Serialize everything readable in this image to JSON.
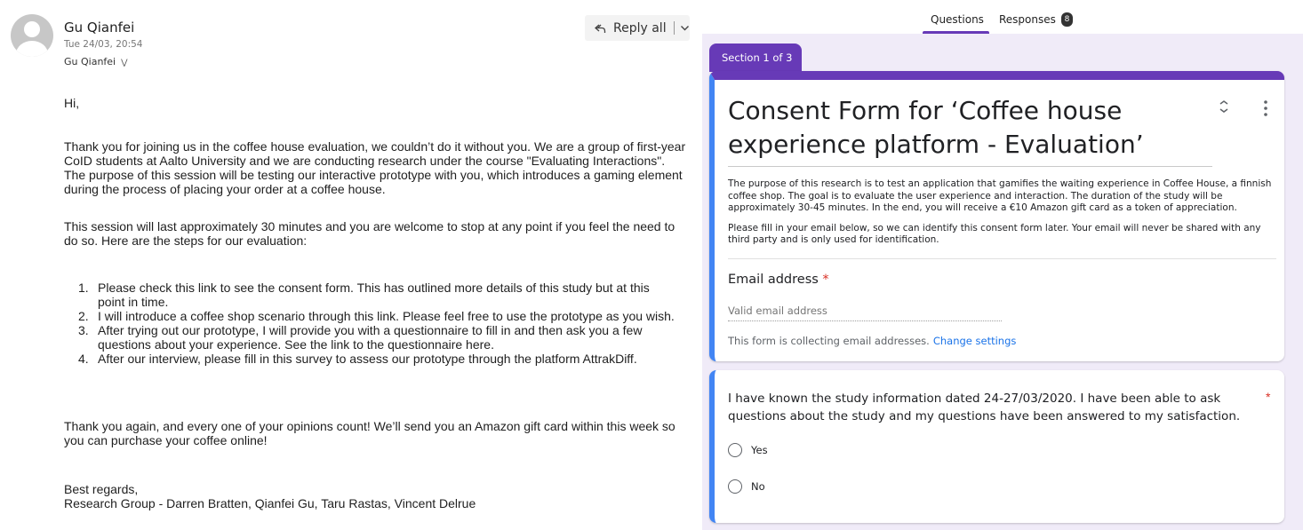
{
  "email": {
    "sender_name": "Gu Qianfei",
    "sent_date": "Tue 24/03, 20:54",
    "to": "Gu Qianfei",
    "reply_all_label": "Reply all",
    "greeting": "Hi,",
    "para1": "Thank you for joining us in the coffee house evaluation, we couldn’t do it without you. We are a group of first-year CoID students at Aalto University and we are conducting research under the course \"Evaluating Interactions\". The purpose of this session will be testing our interactive prototype with you, which introduces a gaming element during the process of placing your order at a coffee house.",
    "para2": "This session will last approximately 30 minutes and you are welcome to stop at any point if you feel the need to do so. Here are the steps for our evaluation:",
    "steps": [
      {
        "num": "1.",
        "before": "Please check ",
        "link": "this link",
        "after": " to see the consent form. This has outlined more details of this study but at this point in time."
      },
      {
        "num": "2.",
        "before": "I will introduce a coffee shop scenario ",
        "link": "through this link",
        "after": ". Please feel free to use the prototype as you wish."
      },
      {
        "num": "3.",
        "before": "After trying out our prototype, I will provide you with a questionnaire to fill in and then ask you a few questions about your experience. See ",
        "link": "the link to the questionnaire",
        "after": " here."
      },
      {
        "num": "4.",
        "before": "After our interview, please fill in ",
        "link": "this survey",
        "after": " to assess our prototype through the platform AttrakDiff."
      }
    ],
    "para3": "Thank you again, and every one of your opinions count! We’ll send you an Amazon gift card within this week so you can purchase your coffee online!",
    "signoff": "Best regards,",
    "signature": "Research Group - Darren Bratten, Qianfei Gu, Taru Rastas, Vincent Delrue"
  },
  "form": {
    "tabs": {
      "questions": "Questions",
      "responses": "Responses",
      "responses_count": "8"
    },
    "section_label": "Section 1 of 3",
    "title": "Consent Form for ‘Coffee house experience platform - Evaluation’",
    "description_1": "The purpose of this research is to test an application that gamifies the waiting experience in Coffee House, a finnish coffee shop. The goal is to evaluate the user experience and interaction. The duration of the study will be approximately 30-45 minutes. In the end, you will receive a €10 Amazon gift card as a token of appreciation.",
    "description_2": "Please fill in your email below, so we can identify this consent form later. Your email will never be shared with any third party and is only used for identification.",
    "email_label": "Email address",
    "required_mark": "*",
    "email_placeholder": "Valid email address",
    "collecting_note": "This form is collecting email addresses.",
    "change_settings": "Change settings",
    "question": "I have known the study information dated 24-27/03/2020. I have been able to ask questions about the study and my questions have been answered to my satisfaction.",
    "options": [
      "Yes",
      "No"
    ],
    "colors": {
      "accent": "#673ab7",
      "focus": "#4285f4",
      "link": "#1a73e8",
      "required": "#d93025",
      "background": "#f0ebf8"
    }
  }
}
